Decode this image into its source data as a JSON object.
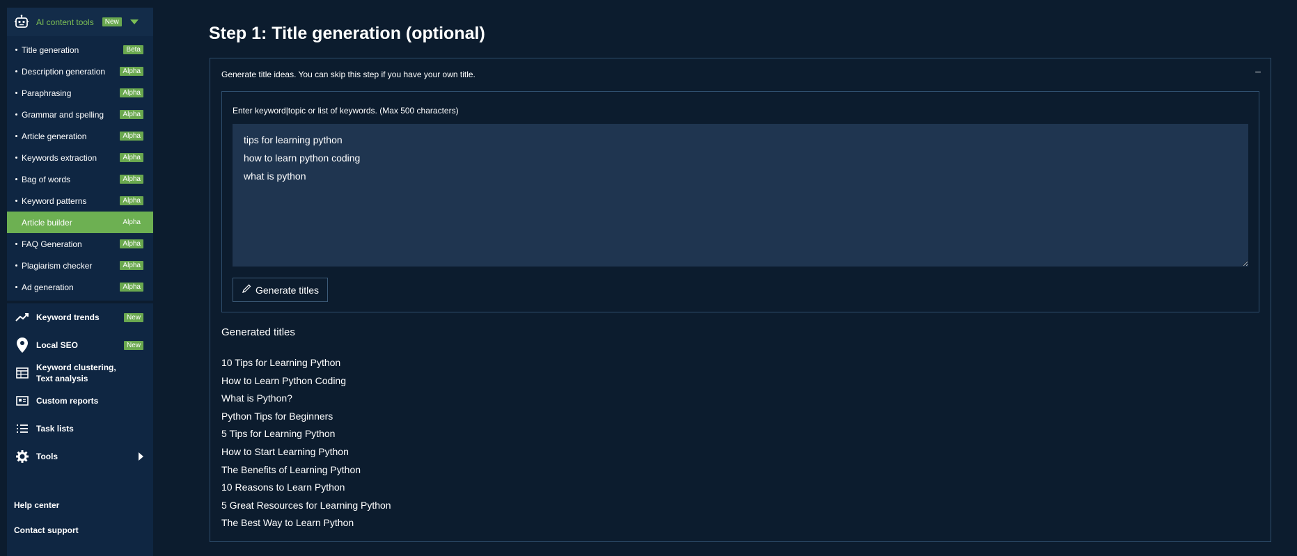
{
  "sidebar": {
    "header": {
      "title": "AI content tools",
      "badge": "New"
    },
    "sub_items": [
      {
        "label": "Title generation",
        "badge": "Beta"
      },
      {
        "label": "Description generation",
        "badge": "Alpha"
      },
      {
        "label": "Paraphrasing",
        "badge": "Alpha"
      },
      {
        "label": "Grammar and spelling",
        "badge": "Alpha"
      },
      {
        "label": "Article generation",
        "badge": "Alpha"
      },
      {
        "label": "Keywords extraction",
        "badge": "Alpha"
      },
      {
        "label": "Bag of words",
        "badge": "Alpha"
      },
      {
        "label": "Keyword patterns",
        "badge": "Alpha"
      },
      {
        "label": "Article builder",
        "badge": "Alpha",
        "active": true
      },
      {
        "label": "FAQ Generation",
        "badge": "Alpha"
      },
      {
        "label": "Plagiarism checker",
        "badge": "Alpha"
      },
      {
        "label": "Ad generation",
        "badge": "Alpha"
      }
    ],
    "nav_items": [
      {
        "label": "Keyword trends",
        "badge": "New",
        "icon": "trend-icon"
      },
      {
        "label": "Local SEO",
        "badge": "New",
        "icon": "location-pin-icon"
      },
      {
        "label": "Keyword clustering, Text analysis",
        "icon": "table-icon"
      },
      {
        "label": "Custom reports",
        "icon": "report-card-icon"
      },
      {
        "label": "Task lists",
        "icon": "list-icon"
      },
      {
        "label": "Tools",
        "icon": "gear-icon"
      }
    ],
    "help_center": "Help center",
    "contact_support": "Contact support"
  },
  "main": {
    "page_title": "Step 1: Title generation (optional)",
    "panel_description": "Generate title ideas. You can skip this step if you have your own title.",
    "collapse_symbol": "–",
    "input_label": "Enter keyword|topic or list of keywords. (Max 500 characters)",
    "keywords_value": "tips for learning python\nhow to learn python coding\nwhat is python",
    "generate_button": "Generate titles",
    "generated_heading": "Generated titles",
    "generated_titles": [
      "10 Tips for Learning Python",
      "How to Learn Python Coding",
      "What is Python?",
      "Python Tips for Beginners",
      "5 Tips for Learning Python",
      "How to Start Learning Python",
      "The Benefits of Learning Python",
      "10 Reasons to Learn Python",
      "5 Great Resources for Learning Python",
      "The Best Way to Learn Python"
    ]
  },
  "colors": {
    "background": "#0c1c2e",
    "sidebar": "#0f2642",
    "accent_green": "#6db052",
    "panel_border": "#2f4f6e"
  }
}
